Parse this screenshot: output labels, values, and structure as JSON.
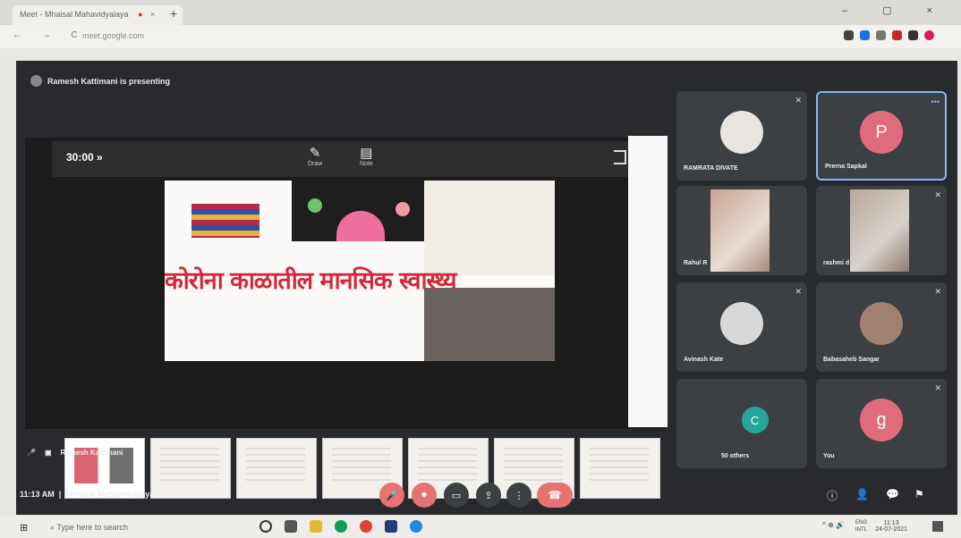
{
  "browser": {
    "tab_title": "Meet - Mhaisal Mahavidyalaya",
    "url": "meet.google.com",
    "record_indicator": "●",
    "tab_close": "×",
    "new_tab": "+",
    "window_controls": "– ▢ ×",
    "nav_buttons": "← → C"
  },
  "meet": {
    "presenting_text": "Ramesh Kattimani is presenting",
    "presenter_share_label": "Ramesh Kattimani",
    "clock": "11:13 AM",
    "meeting_name": "Mhaisal Mahavidyalaya Mhaisal",
    "zoom_level": "30:00",
    "tools": [
      {
        "label": "Draw",
        "icon": "pen-icon",
        "glyph": "✎"
      },
      {
        "label": "Note",
        "icon": "note-icon",
        "glyph": "▤"
      }
    ],
    "slide_heading": "कोरोना काळातील मानसिक स्वास्थ्य",
    "participants": [
      {
        "name": "RAMRATA DIVATE",
        "initial": "",
        "color": "#e8e4e0"
      },
      {
        "name": "Prerna Sapkal",
        "initial": "P",
        "color": "#e06b7b"
      },
      {
        "name": "Rahul R",
        "initial": "",
        "color": ""
      },
      {
        "name": "rashmi d",
        "initial": "",
        "color": ""
      },
      {
        "name": "Avinash Kate",
        "initial": "",
        "color": "#d8d8d8"
      },
      {
        "name": "Babasaheb Sangar",
        "initial": "",
        "color": "#a08070"
      },
      {
        "name": "50 others",
        "initial": "C",
        "color": "#26a69a"
      },
      {
        "name": "You",
        "initial": "g",
        "color": "#e06b7b"
      }
    ],
    "controls": {
      "mic": "🎤",
      "camera": "⏺",
      "captions": "▭",
      "present": "⇪",
      "more": "⋮",
      "end_call": "☎",
      "info": "ⓘ",
      "people": "👤",
      "chat": "💬",
      "activities": "⚑"
    }
  },
  "taskbar": {
    "search_placeholder": "Type here to search",
    "lang_top": "ENG",
    "lang_bottom": "INTL",
    "time": "11:13",
    "date": "24-07-2021",
    "start": "⊞",
    "tray_icons": "^ ⊕ 🔊"
  },
  "colors": {
    "meet_bg": "#292a2d",
    "tile_bg": "#3c4043",
    "accent": "#8ab4f8",
    "danger": "#e57373"
  }
}
